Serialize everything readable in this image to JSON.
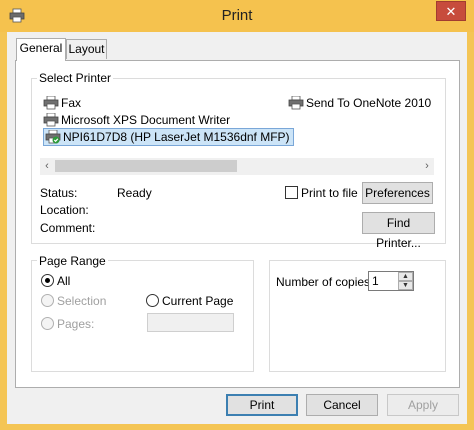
{
  "window": {
    "title": "Print",
    "close_glyph": "✕",
    "icon": "printer-icon"
  },
  "tabs": [
    {
      "label": "General"
    },
    {
      "label": "Layout"
    }
  ],
  "select_printer": {
    "group_label": "Select Printer",
    "printers": [
      {
        "name": "Fax"
      },
      {
        "name": "Send To OneNote 2010"
      },
      {
        "name": "Microsoft XPS Document Writer"
      },
      {
        "name": "NPI61D7D8 (HP LaserJet M1536dnf MFP)",
        "selected": true
      }
    ],
    "scroll_left": "‹",
    "scroll_right": "›"
  },
  "status": {
    "status_label": "Status:",
    "status_value": "Ready",
    "location_label": "Location:",
    "comment_label": "Comment:"
  },
  "print_to_file": {
    "label": "Print to file",
    "checked": false
  },
  "buttons": {
    "preferences": "Preferences",
    "find_printer": "Find Printer...",
    "print": "Print",
    "cancel": "Cancel",
    "apply": "Apply"
  },
  "page_range": {
    "group_label": "Page Range",
    "all": "All",
    "selection": "Selection",
    "current_page": "Current Page",
    "pages": "Pages:",
    "pages_value": "",
    "selected_option": "All"
  },
  "copies": {
    "label": "Number of copies:",
    "value": "1",
    "up": "▲",
    "down": "▼"
  },
  "colors": {
    "title_bar": "#f5c24e",
    "close_button": "#c74c3c",
    "selection_highlight": "#cce4f7",
    "default_button_border": "#3c7fb1"
  }
}
